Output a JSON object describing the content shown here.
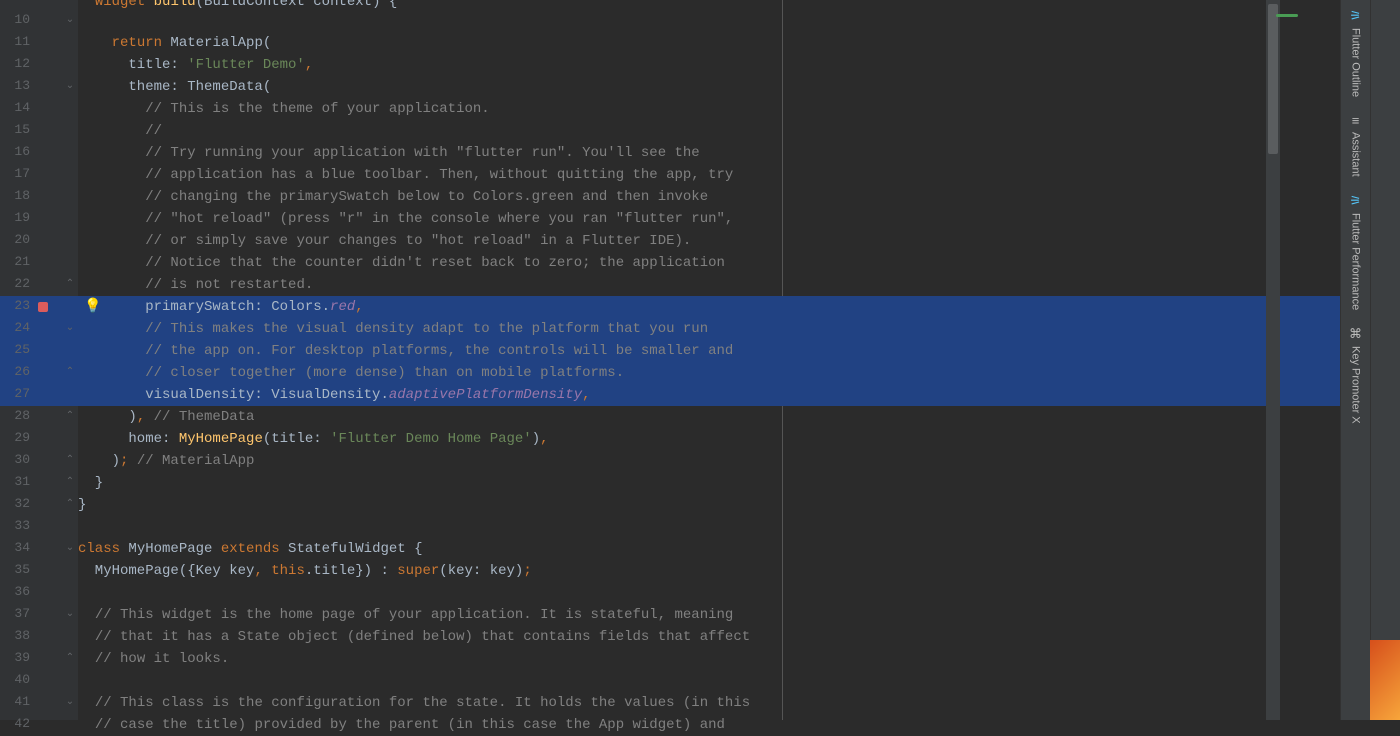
{
  "editor": {
    "top_partial_html": "  <span class='kw'>Widget</span> <span class='fn'>build</span>(BuildContext context) {",
    "first_line_number": 10,
    "lines": [
      {
        "n": 10,
        "fold": "⌄",
        "html": ""
      },
      {
        "n": 11,
        "fold": "",
        "html": "    <span class='kw'>return</span> MaterialApp("
      },
      {
        "n": 12,
        "fold": "",
        "html": "      title: <span class='str'>'Flutter Demo'</span><span class='pun'>,</span>"
      },
      {
        "n": 13,
        "fold": "⌄",
        "html": "      theme: ThemeData("
      },
      {
        "n": 14,
        "fold": "",
        "html": "        <span class='com'>// This is the theme of your application.</span>"
      },
      {
        "n": 15,
        "fold": "",
        "html": "        <span class='com'>//</span>"
      },
      {
        "n": 16,
        "fold": "",
        "html": "        <span class='com'>// Try running your application with \"flutter run\". You'll see the</span>"
      },
      {
        "n": 17,
        "fold": "",
        "html": "        <span class='com'>// application has a blue toolbar. Then, without quitting the app, try</span>"
      },
      {
        "n": 18,
        "fold": "",
        "html": "        <span class='com'>// changing the primarySwatch below to Colors.green and then invoke</span>"
      },
      {
        "n": 19,
        "fold": "",
        "html": "        <span class='com'>// \"hot reload\" (press \"r\" in the console where you ran \"flutter run\",</span>"
      },
      {
        "n": 20,
        "fold": "",
        "html": "        <span class='com'>// or simply save your changes to \"hot reload\" in a Flutter IDE).</span>"
      },
      {
        "n": 21,
        "fold": "",
        "html": "        <span class='com'>// Notice that the counter didn't reset back to zero; the application</span>"
      },
      {
        "n": 22,
        "fold": "⌃",
        "html": "        <span class='com'>// is not restarted.</span>"
      },
      {
        "n": 23,
        "fold": "",
        "sel": true,
        "bp": true,
        "bulb": true,
        "html": "        primarySwatch: Colors.<span class='ital'>red</span><span class='pun'>,</span>"
      },
      {
        "n": 24,
        "fold": "⌄",
        "sel": true,
        "html": "        <span class='com'>// This makes the visual density adapt to the platform that you run</span>"
      },
      {
        "n": 25,
        "fold": "",
        "sel": true,
        "html": "        <span class='com'>// the app on. For desktop platforms, the controls will be smaller and</span>"
      },
      {
        "n": 26,
        "fold": "⌃",
        "sel": true,
        "html": "        <span class='com'>// closer together (more dense) than on mobile platforms.</span>"
      },
      {
        "n": 27,
        "fold": "",
        "sel": true,
        "html": "        visualDensity: VisualDensity.<span class='ital'>adaptivePlatformDensity</span><span class='pun'>,</span>"
      },
      {
        "n": 28,
        "fold": "⌃",
        "html": "      )<span class='pun'>,</span> <span class='com'>// ThemeData</span>"
      },
      {
        "n": 29,
        "fold": "",
        "html": "      home: <span class='fn'>MyHomePage</span>(title: <span class='str'>'Flutter Demo Home Page'</span>)<span class='pun'>,</span>"
      },
      {
        "n": 30,
        "fold": "⌃",
        "html": "    )<span class='pun'>;</span> <span class='com'>// MaterialApp</span>"
      },
      {
        "n": 31,
        "fold": "⌃",
        "html": "  }"
      },
      {
        "n": 32,
        "fold": "⌃",
        "html": "}"
      },
      {
        "n": 33,
        "fold": "",
        "html": ""
      },
      {
        "n": 34,
        "fold": "⌄",
        "html": "<span class='kw'>class</span> MyHomePage <span class='kw'>extends</span> StatefulWidget {"
      },
      {
        "n": 35,
        "fold": "",
        "html": "  MyHomePage({Key key<span class='pun'>,</span> <span class='kw'>this</span>.title}) : <span class='kw'>super</span>(key: key)<span class='pun'>;</span>"
      },
      {
        "n": 36,
        "fold": "",
        "html": ""
      },
      {
        "n": 37,
        "fold": "⌄",
        "html": "  <span class='com'>// This widget is the home page of your application. It is stateful, meaning</span>"
      },
      {
        "n": 38,
        "fold": "",
        "html": "  <span class='com'>// that it has a State object (defined below) that contains fields that affect</span>"
      },
      {
        "n": 39,
        "fold": "⌃",
        "html": "  <span class='com'>// how it looks.</span>"
      },
      {
        "n": 40,
        "fold": "",
        "html": ""
      },
      {
        "n": 41,
        "fold": "⌄",
        "html": "  <span class='com'>// This class is the configuration for the state. It holds the values (in this</span>"
      },
      {
        "n": 42,
        "fold": "",
        "html": "  <span class='com'>// case the title) provided by the parent (in this case the App widget) and</span>"
      }
    ]
  },
  "panels": {
    "col1": [
      {
        "icon": "⚞",
        "icon_class": "flutter-icon",
        "label": "Flutter Outline"
      },
      {
        "icon": "≡",
        "icon_class": "",
        "label": "Assistant"
      },
      {
        "icon": "⚞",
        "icon_class": "flutter-icon",
        "label": "Flutter Performance"
      },
      {
        "icon": "⌘",
        "icon_class": "",
        "label": "Key Promoter X"
      }
    ]
  }
}
